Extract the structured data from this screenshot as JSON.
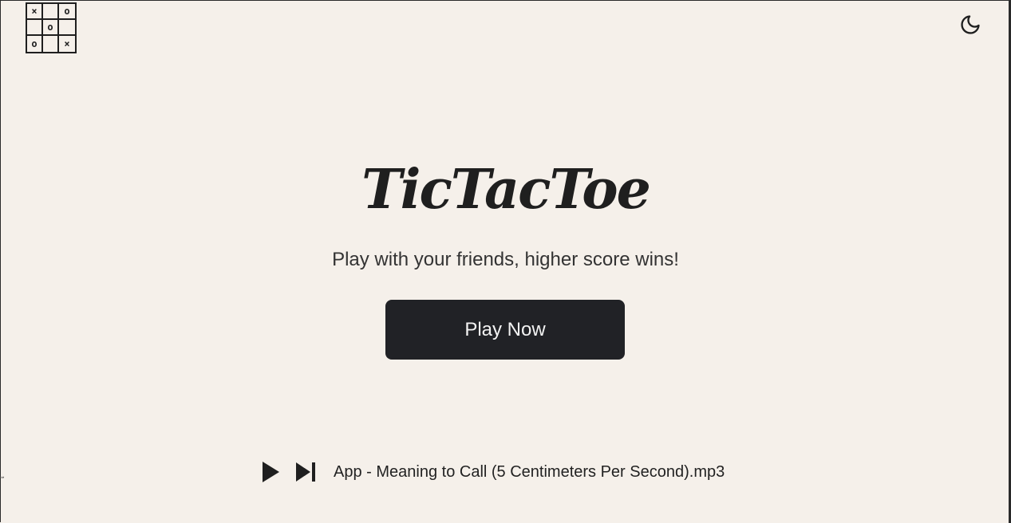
{
  "logo": {
    "cells": [
      "×",
      "",
      "o",
      "",
      "o",
      "",
      "o",
      "",
      "×"
    ]
  },
  "header": {
    "theme_toggle_icon": "moon-icon"
  },
  "hero": {
    "title": "TicTacToe",
    "subtitle": "Play with your friends, higher score wins!",
    "play_button": "Play Now"
  },
  "player": {
    "play_icon": "play-icon",
    "next_icon": "skip-next-icon",
    "track": "App - Meaning to Call (5 Centimeters Per Second).mp3"
  },
  "corner_mark": "„",
  "colors": {
    "background": "#f5f0ea",
    "button": "#212226",
    "text": "#1f1f1f"
  }
}
